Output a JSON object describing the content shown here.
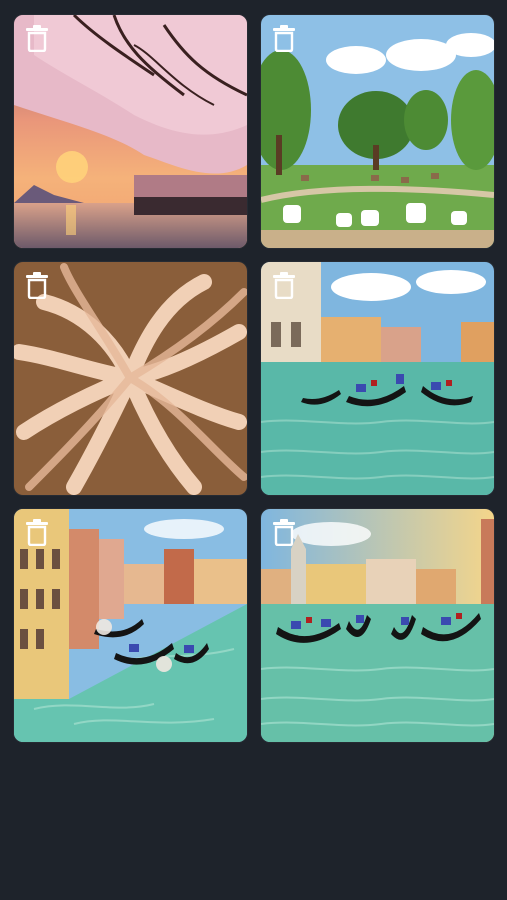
{
  "gallery": {
    "items": [
      {
        "subject": "cherry-blossom-sunset",
        "delete_icon": "trash-icon"
      },
      {
        "subject": "dogs-in-park",
        "delete_icon": "trash-icon"
      },
      {
        "subject": "swirling-hands",
        "delete_icon": "trash-icon"
      },
      {
        "subject": "venice-gondolas-canal",
        "delete_icon": "trash-icon"
      },
      {
        "subject": "venice-canal-buildings",
        "delete_icon": "trash-icon"
      },
      {
        "subject": "venice-gondolas-cathedral",
        "delete_icon": "trash-icon"
      }
    ]
  },
  "colors": {
    "background": "#1e232b",
    "icon": "#ffffff"
  }
}
